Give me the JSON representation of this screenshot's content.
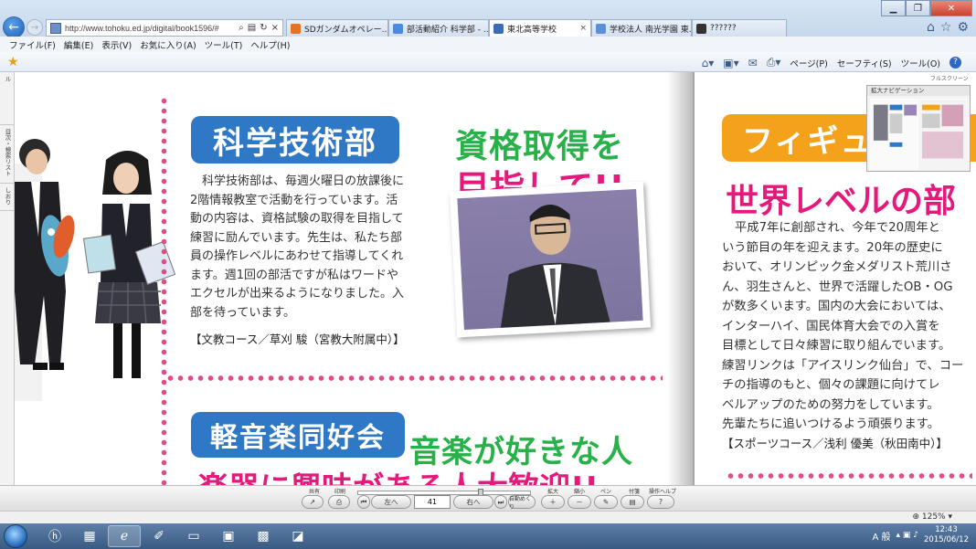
{
  "browser": {
    "url": "http://www.tohoku.ed.jp/digital/book1596/#",
    "tabs": [
      {
        "label": "SDガンダムオペレー...",
        "icon_color": "#e8731e",
        "active": false
      },
      {
        "label": "部活動紹介 科学部 - ...",
        "icon_color": "#4a8ae0",
        "active": false
      },
      {
        "label": "東北高等学校",
        "icon_color": "#3b6bb0",
        "active": true
      },
      {
        "label": "学校法人 南光学園 東...",
        "icon_color": "#5d8fd4",
        "active": false
      },
      {
        "label": "??????",
        "icon_color": "#333333",
        "active": false
      }
    ],
    "menu": [
      "ファイル(F)",
      "編集(E)",
      "表示(V)",
      "お気に入り(A)",
      "ツール(T)",
      "ヘルプ(H)"
    ],
    "command_bar": {
      "page": "ページ(P)",
      "safety": "セーフティ(S)",
      "tools": "ツール(O)"
    }
  },
  "viewer": {
    "side_tabs": [
      "目次・ビジュアル",
      "目次・検索リスト",
      "しおり"
    ],
    "fullscreen_label": "フルスクリーン",
    "nav_panel_title": "拡大ナビゲーション",
    "left_page": {
      "science_club": {
        "title": "科学技術部",
        "catch_line1": "資格取得を",
        "catch_line2": "目指して!!",
        "body": [
          "科学技術部は、毎週火曜日の放課後に",
          "2階情報教室で活動を行っています。活",
          "動の内容は、資格試験の取得を目指して",
          "練習に励んでいます。先生は、私たち部",
          "員の操作レベルにあわせて指導してくれ",
          "ます。週1回の部活ですが私はワードや",
          "エクセルが出来るようになりました。入",
          "部を待っています。"
        ],
        "credit": "【文教コース／草刈 駿（宮教大附属中）】"
      },
      "music_club": {
        "title": "軽音楽同好会",
        "catch_line1": "音楽が好きな人",
        "catch_line2": "楽器に興味がある人大歓迎!!"
      }
    },
    "right_page": {
      "skating_club": {
        "title": "フィギュ",
        "catch": "世界レベルの部",
        "body": [
          "平成7年に創部され、今年で20周年と",
          "いう節目の年を迎えます。20年の歴史に",
          "おいて、オリンピック金メダリスト荒川さ",
          "ん、羽生さんと、世界で活躍したOB・OG",
          "が数多くいます。国内の大会においては、",
          "インターハイ、国民体育大会での入賞を",
          "目標として日々練習に取り組んでいます。",
          "練習リンクは「アイスリンク仙台」で、コー",
          "チの指導のもと、個々の課題に向けてレ",
          "ベルアップのための努力をしています。",
          "先輩たちに追いつけるよう頑張ります。"
        ],
        "credit": "【スポーツコース／浅利 優美（秋田南中）】"
      }
    }
  },
  "toolbar": {
    "labels": {
      "share": "共有",
      "print": "印刷",
      "zoom_in": "拡大",
      "zoom_out": "縮小",
      "pen": "ペン",
      "note": "付箋",
      "help": "操作ヘルプ"
    },
    "prev_label": "左へ",
    "page_number": "41",
    "next_label": "右へ",
    "auto_label": "自動めくり",
    "slider_position": 0.73
  },
  "status": {
    "zoom": "125%"
  },
  "taskbar": {
    "time": "12:43",
    "date": "2015/06/12",
    "ime": "A 般"
  }
}
